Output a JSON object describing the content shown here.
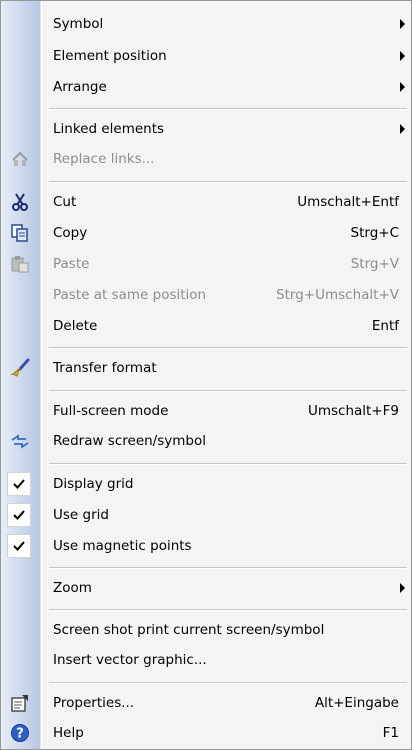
{
  "menu": {
    "symbol": {
      "label": "Symbol"
    },
    "element_position": {
      "label": "Element position"
    },
    "arrange": {
      "label": "Arrange"
    },
    "linked_elements": {
      "label": "Linked elements"
    },
    "replace_links": {
      "label": "Replace links...",
      "icon": "replace-links-icon",
      "enabled": false
    },
    "cut": {
      "label": "Cut",
      "shortcut": "Umschalt+Entf",
      "icon": "scissors-icon"
    },
    "copy": {
      "label": "Copy",
      "shortcut": "Strg+C",
      "icon": "copy-icon"
    },
    "paste": {
      "label": "Paste",
      "shortcut": "Strg+V",
      "icon": "paste-icon",
      "enabled": false
    },
    "paste_same_position": {
      "label": "Paste at same position",
      "shortcut": "Strg+Umschalt+V",
      "enabled": false
    },
    "delete": {
      "label": "Delete",
      "shortcut": "Entf"
    },
    "transfer_format": {
      "label": "Transfer format",
      "icon": "brush-icon"
    },
    "full_screen": {
      "label": "Full-screen mode",
      "shortcut": "Umschalt+F9"
    },
    "redraw": {
      "label": "Redraw screen/symbol",
      "icon": "redraw-icon"
    },
    "display_grid": {
      "label": "Display grid",
      "checked": true
    },
    "use_grid": {
      "label": "Use grid",
      "checked": true
    },
    "use_magnetic_points": {
      "label": "Use magnetic points",
      "checked": true
    },
    "zoom": {
      "label": "Zoom"
    },
    "screenshot_print": {
      "label": "Screen shot print current screen/symbol"
    },
    "insert_vector": {
      "label": "Insert vector graphic..."
    },
    "properties": {
      "label": "Properties...",
      "shortcut": "Alt+Eingabe",
      "icon": "properties-icon"
    },
    "help": {
      "label": "Help",
      "shortcut": "F1",
      "icon": "help-icon"
    }
  },
  "colors": {
    "gutter": "#c9d6ea",
    "menu_bg": "#f4f4f4",
    "disabled_text": "#8d8d8d",
    "border": "#979797"
  }
}
